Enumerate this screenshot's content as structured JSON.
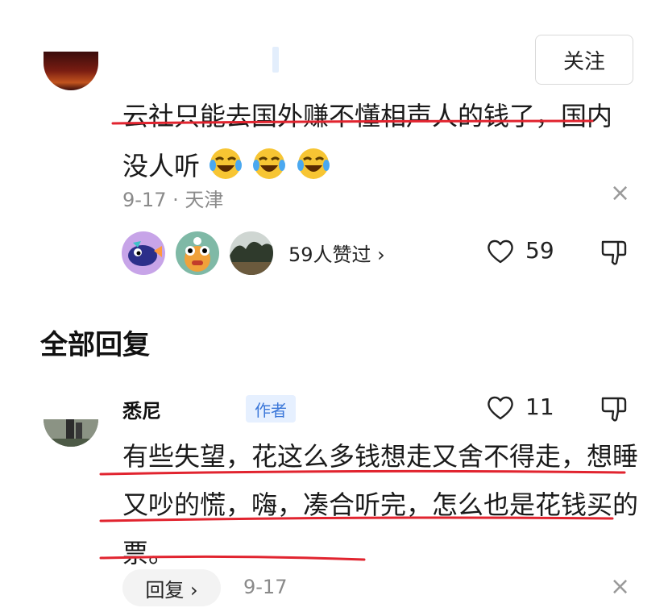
{
  "top_comment": {
    "follow_label": "关注",
    "text": "云社只能去国外赚不懂相声人的钱了，国内没人听",
    "emoji": [
      "laughing-crying-emoji",
      "laughing-crying-emoji",
      "laughing-crying-emoji"
    ],
    "date_location": "9-17 · 天津",
    "likers_text": "59人赞过 ›",
    "like_count": "59"
  },
  "replies_section": {
    "title": "全部回复"
  },
  "reply": {
    "name": "悉尼",
    "author_badge": "作者",
    "like_count": "11",
    "text": "有些失望，花这么多钱想走又舍不得走，想睡又吵的慌，嗨，凑合听完，怎么也是花钱买的票。",
    "reply_button": "回复 ›",
    "date": "9-17"
  },
  "colors": {
    "underline": "#e1242f",
    "muted": "#8a8a8a",
    "badge_bg": "#e6f0ff",
    "badge_text": "#3b77d9"
  },
  "close_glyph": "×"
}
